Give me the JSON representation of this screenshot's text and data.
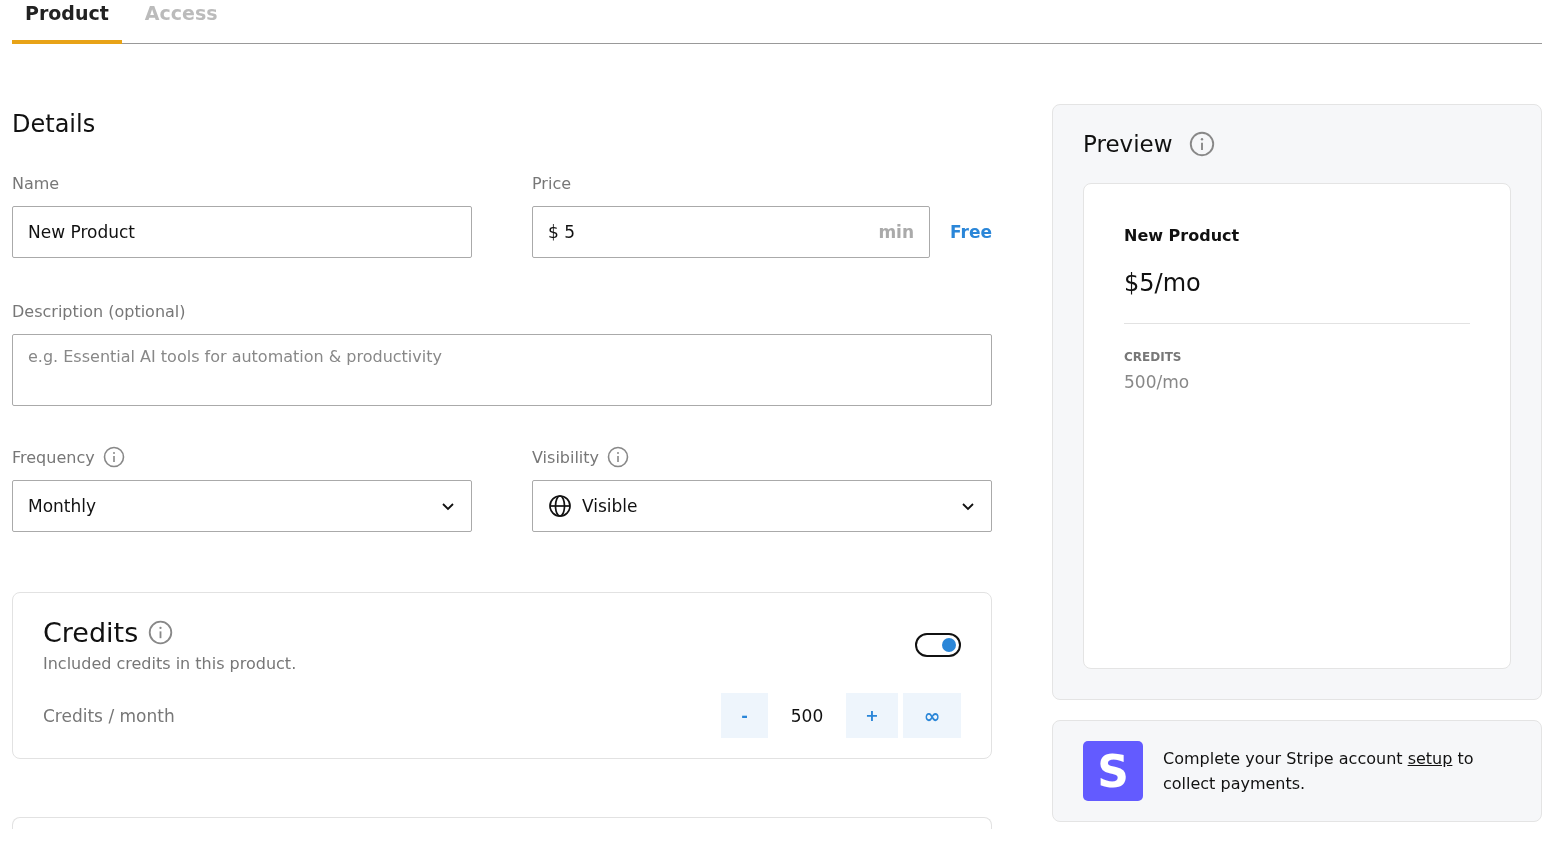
{
  "tabs": [
    {
      "label": "Product",
      "selected": true
    },
    {
      "label": "Access",
      "selected": false
    }
  ],
  "details": {
    "title": "Details",
    "name": {
      "label": "Name",
      "value": "New Product"
    },
    "price": {
      "label": "Price",
      "currency": "$",
      "value": "5",
      "suffix": "min",
      "free_link": "Free"
    },
    "description": {
      "label": "Description (optional)",
      "placeholder": "e.g. Essential AI tools for automation & productivity"
    },
    "frequency": {
      "label": "Frequency",
      "value": "Monthly"
    },
    "visibility": {
      "label": "Visibility",
      "value": "Visible"
    }
  },
  "credits": {
    "title": "Credits",
    "subtitle": "Included credits in this product.",
    "on": true,
    "row_label": "Credits / month",
    "decrement": "-",
    "amount": "500",
    "increment": "+",
    "unlimited": "∞"
  },
  "preview": {
    "title": "Preview",
    "product_name": "New Product",
    "price": "$5/mo",
    "credits_label": "CREDITS",
    "credits_value": "500/mo"
  },
  "stripe": {
    "logo": "S",
    "text_before": "Complete your Stripe account ",
    "link": "setup",
    "text_after": " to collect payments."
  }
}
